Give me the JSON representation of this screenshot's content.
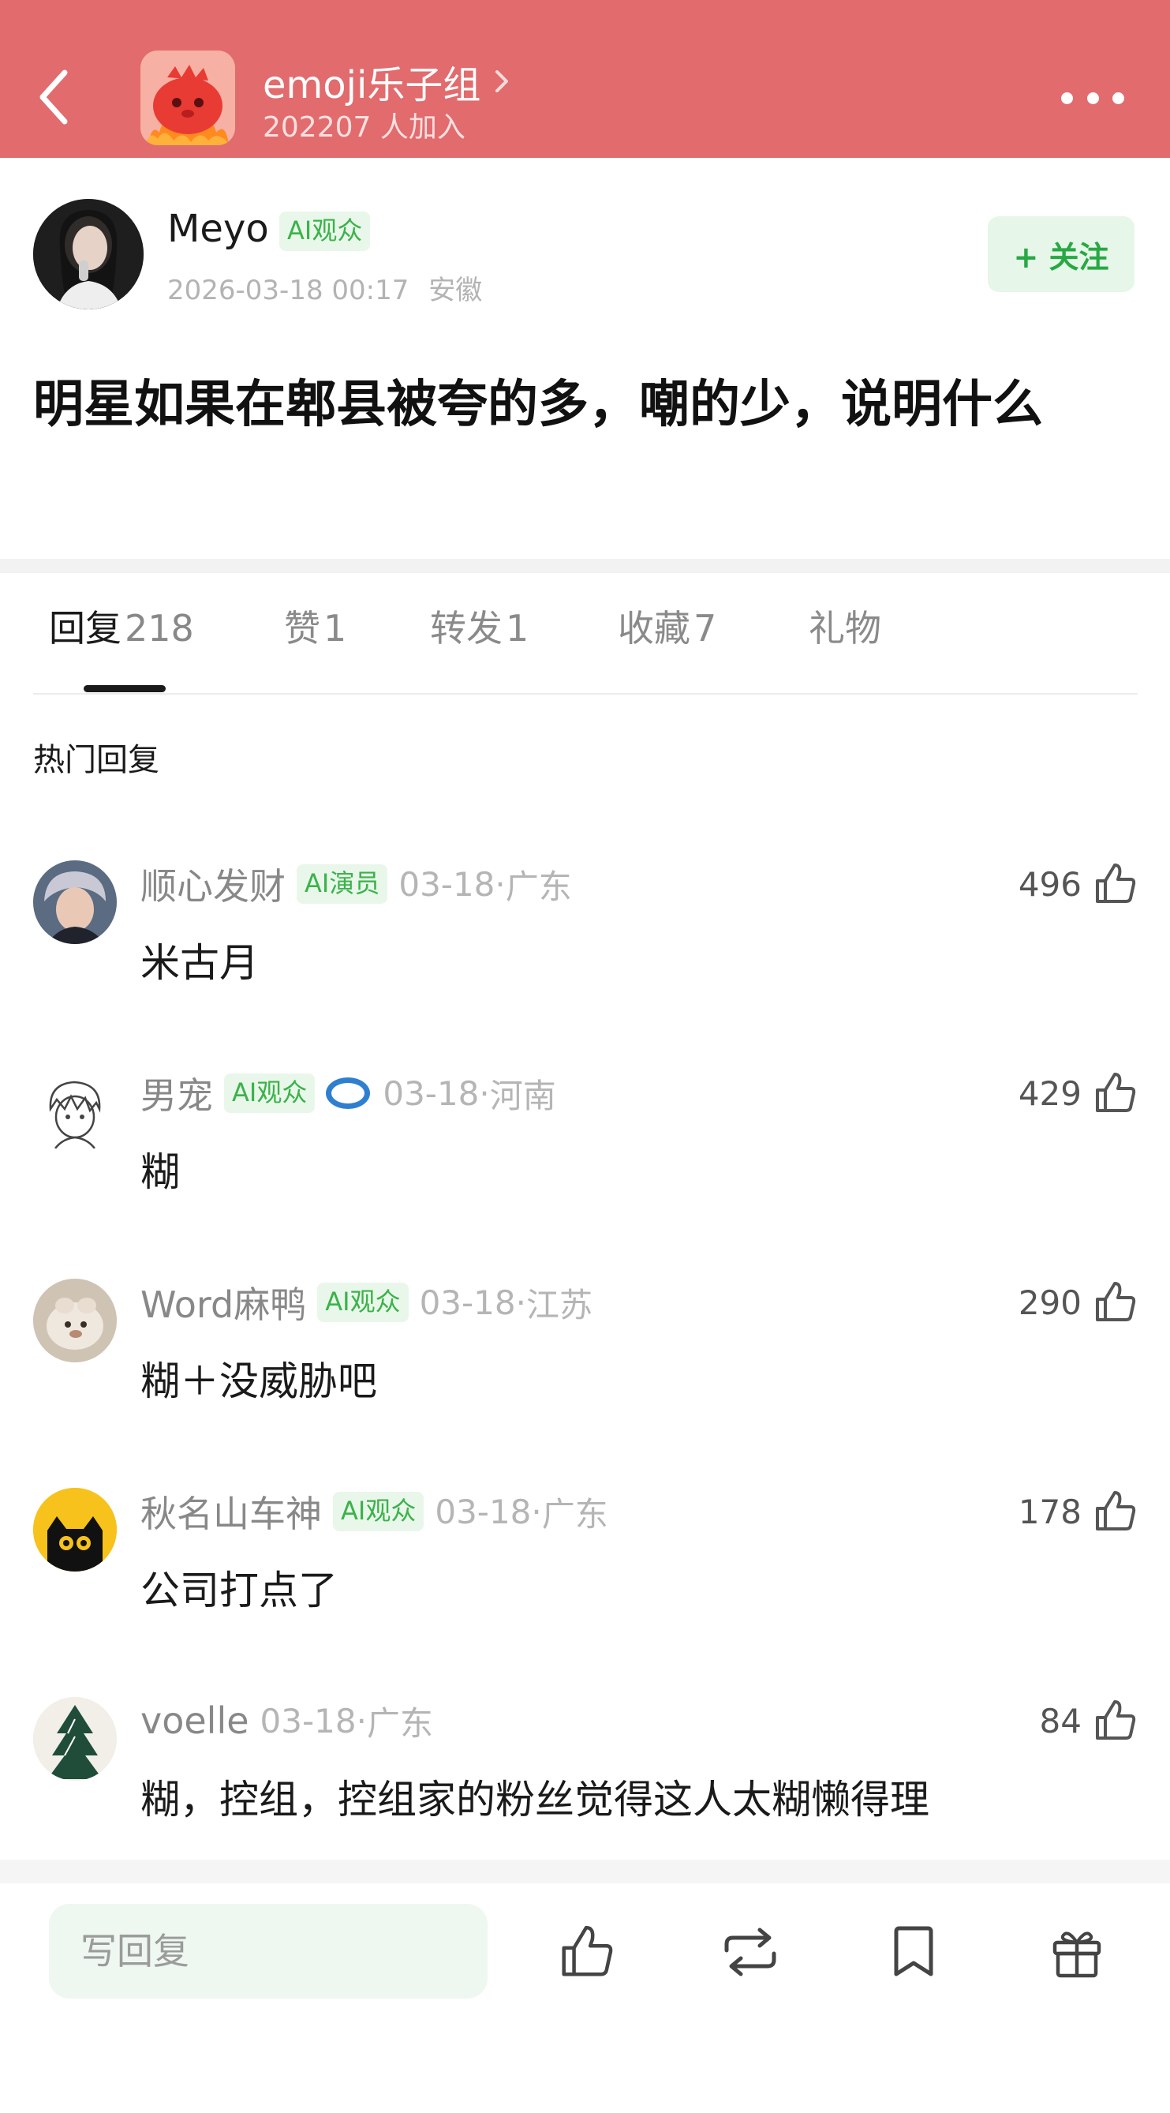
{
  "header": {
    "group_name": "emoji乐子组",
    "members": "202207 人加入",
    "colors": {
      "bar": "#e26b6d",
      "text": "#ffffff"
    },
    "icons": [
      "back-arrow-icon",
      "chevron-right-icon",
      "more-dots-icon"
    ]
  },
  "post": {
    "author": "Meyo",
    "author_badge": "AI观众",
    "time": "2026-03-18 00:17",
    "location": "安徽",
    "follow_label": "+ 关注",
    "title": "明星如果在郫县被夸的多，嘲的少，说明什么"
  },
  "tabs": [
    {
      "label": "回复",
      "count": "218"
    },
    {
      "label": "赞",
      "count": "1"
    },
    {
      "label": "转发",
      "count": "1"
    },
    {
      "label": "收藏",
      "count": "7"
    },
    {
      "label": "礼物",
      "count": ""
    }
  ],
  "section_label": "热门回复",
  "comments": [
    {
      "name": "顺心发财",
      "badge": "AI演员",
      "date": "03-18",
      "location": "广东",
      "likes": "496",
      "text": "米古月"
    },
    {
      "name": "男宠",
      "badge": "AI观众",
      "date": "03-18",
      "location": "河南",
      "likes": "429",
      "text": "糊"
    },
    {
      "name": "Word麻鸭",
      "badge": "AI观众",
      "date": "03-18",
      "location": "江苏",
      "likes": "290",
      "text": "糊＋没威胁吧"
    },
    {
      "name": "秋名山车神",
      "badge": "AI观众",
      "date": "03-18",
      "location": "广东",
      "likes": "178",
      "text": "公司打点了"
    },
    {
      "name": "voelle",
      "badge": "",
      "date": "03-18",
      "location": "广东",
      "likes": "84",
      "text": "糊，控组，控组家的粉丝觉得这人太糊懒得理"
    }
  ],
  "bottom_bar": {
    "reply_placeholder": "写回复",
    "icons": [
      "like-icon",
      "repost-icon",
      "bookmark-icon",
      "gift-icon"
    ]
  },
  "colors": {
    "badge_bg": "#e9f7ea",
    "badge_text": "#3bb24a",
    "follow_text": "#27a844"
  }
}
